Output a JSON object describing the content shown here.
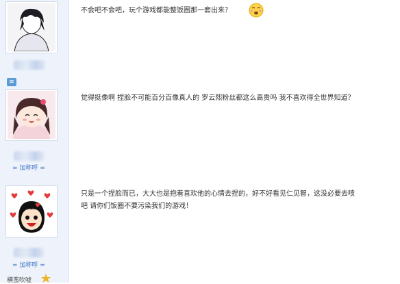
{
  "posts": [
    {
      "text": "不会吧不会吧，玩个游戏都能整饭圈那一套出来？"
    },
    {
      "text": "觉得挺像啊 捏脸不可能百分百像真人的 罗云熙粉丝都这么高贵吗 我不喜欢得全世界知道？"
    },
    {
      "line1": "只是一个捏脸而已，大大也是抱着喜欢他的心情去捏的，好不好看见仁见智，这没必要去喷",
      "line2": "吧  请你们饭圈不要污染我们的游戏！"
    }
  ],
  "sidebar": {
    "add_title_label_1": "= 加称呼 =",
    "add_title_label_2": "= 加称呼 =",
    "bottom_label": "横蛮吹嘘"
  },
  "colors": {
    "sidebar_bg": "#eef3fb",
    "link": "#3b73c4"
  }
}
